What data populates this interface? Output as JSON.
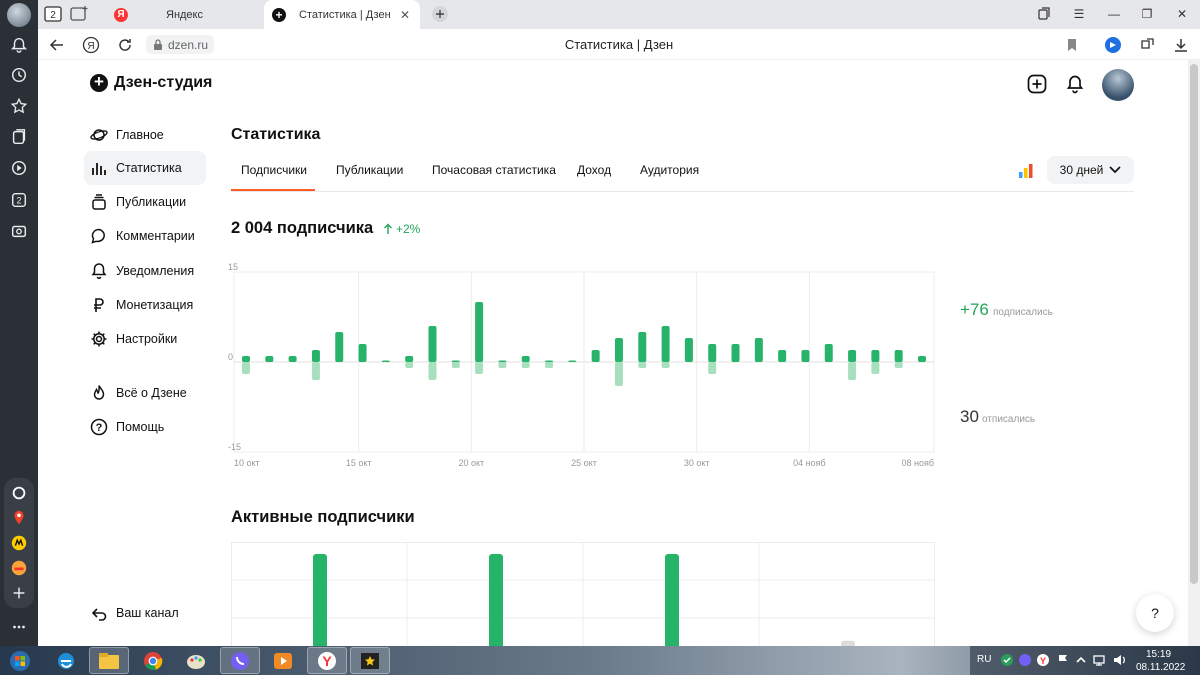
{
  "browser": {
    "tab_counter": "2",
    "tabs": [
      {
        "label": "Яндекс"
      },
      {
        "label": "Статистика | Дзен"
      }
    ],
    "url": "dzen.ru",
    "page_title": "Статистика | Дзен"
  },
  "app": {
    "logo": "Дзен-студия"
  },
  "nav": {
    "items": [
      {
        "label": "Главное",
        "icon": "planet-icon"
      },
      {
        "label": "Статистика",
        "icon": "bar-chart-icon"
      },
      {
        "label": "Публикации",
        "icon": "stack-icon"
      },
      {
        "label": "Комментарии",
        "icon": "comment-icon"
      },
      {
        "label": "Уведомления",
        "icon": "bell-icon"
      },
      {
        "label": "Монетизация",
        "icon": "ruble-icon"
      },
      {
        "label": "Настройки",
        "icon": "gear-icon"
      },
      {
        "label": "Всё о Дзене",
        "icon": "flame-icon"
      },
      {
        "label": "Помощь",
        "icon": "help-icon"
      }
    ],
    "channel_link": "Ваш канал"
  },
  "stats": {
    "title": "Статистика",
    "tabs": [
      "Подписчики",
      "Публикации",
      "Почасовая статистика",
      "Доход",
      "Аудитория"
    ],
    "period": "30 дней",
    "subscribers_count": "2 004 подписчика",
    "growth": "+2%",
    "subscribed_value": "+76",
    "subscribed_label": "подписались",
    "unsubscribed_value": "30",
    "unsubscribed_label": "отписались",
    "active_title": "Активные подписчики",
    "help": "?"
  },
  "colors": {
    "positive": "#27b36a",
    "negative": "#a8e0bf",
    "accent_tab": "#ff5a2a"
  },
  "chart_data": [
    {
      "type": "bar",
      "title": "",
      "ylim": [
        -15,
        15
      ],
      "y_ticks": [
        "15",
        "0",
        "-15"
      ],
      "x_tick_labels": [
        "10 окт",
        "15 окт",
        "20 окт",
        "25 окт",
        "30 окт",
        "04 нояб",
        "08 нояб"
      ],
      "grid": true,
      "series": [
        {
          "name": "подписались",
          "values": [
            1,
            1,
            1,
            2,
            5,
            3,
            0,
            1,
            6,
            0,
            10,
            0,
            1,
            0,
            0,
            2,
            4,
            5,
            6,
            4,
            3,
            3,
            4,
            2,
            2,
            3,
            2,
            2,
            2,
            1
          ]
        },
        {
          "name": "отписались",
          "values": [
            -2,
            0,
            0,
            -3,
            0,
            0,
            0,
            -1,
            -3,
            -1,
            -2,
            -1,
            -1,
            -1,
            0,
            0,
            -4,
            -1,
            -1,
            0,
            -2,
            0,
            0,
            0,
            0,
            0,
            -3,
            -2,
            -1,
            0
          ]
        }
      ]
    },
    {
      "type": "bar",
      "title": "Активные подписчики",
      "series": [
        {
          "name": "",
          "values": [
            1,
            1,
            1,
            0.15
          ]
        }
      ]
    }
  ],
  "taskbar": {
    "lang": "RU",
    "time": "15:19",
    "date": "08.11.2022"
  }
}
